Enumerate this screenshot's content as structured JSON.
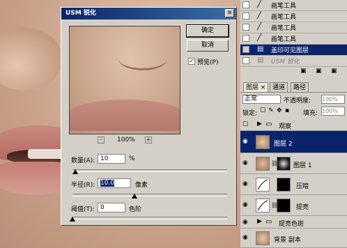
{
  "dialog": {
    "title": "USM 锐化",
    "close_glyph": "✕",
    "ok_label": "确定",
    "cancel_label": "取消",
    "preview_label": "预览(P)",
    "preview_checked": true,
    "zoom_minus": "-",
    "zoom_plus": "+",
    "zoom_level": "100%",
    "amount_label": "数量(A):",
    "amount_value": "10",
    "amount_unit": "%",
    "amount_fraction": 0.02,
    "radius_label": "半径(R):",
    "radius_value": "10.0",
    "radius_unit": "像素",
    "radius_fraction": 0.4,
    "threshold_label": "阈值(T):",
    "threshold_value": "0",
    "threshold_unit": "色阶",
    "threshold_fraction": 0.0
  },
  "history": {
    "items": [
      {
        "label": "画笔工具",
        "icon": "brush-icon"
      },
      {
        "label": "画笔工具",
        "icon": "brush-icon"
      },
      {
        "label": "画笔工具",
        "icon": "brush-icon"
      },
      {
        "label": "画笔工具",
        "icon": "brush-icon"
      },
      {
        "label": "盖印可见图层",
        "icon": "layer-icon",
        "selected": true
      },
      {
        "label": "USM 锐化",
        "icon": "layer-icon",
        "dimmed": true
      }
    ]
  },
  "layers_panel": {
    "tabs": [
      "图层 ×",
      "通道",
      "路径"
    ],
    "blend_mode": "正常",
    "opacity_label": "不透明度:",
    "opacity_value": "100%",
    "lock_label": "锁定:",
    "fill_label": "填充:",
    "fill_value": "100%",
    "layers": [
      {
        "name": "观察",
        "type": "group"
      },
      {
        "name": "图层 2",
        "selected": true
      },
      {
        "name": "图层 1",
        "masked": true
      },
      {
        "name": "压暗",
        "adjustment": true
      },
      {
        "name": "提亮",
        "adjustment": true
      },
      {
        "name": "提亮色斑",
        "type": "group"
      },
      {
        "name": "背景 副本"
      }
    ]
  },
  "colors": {
    "selection": "#0a246a",
    "dialog_bg": "#d4d0c8"
  }
}
